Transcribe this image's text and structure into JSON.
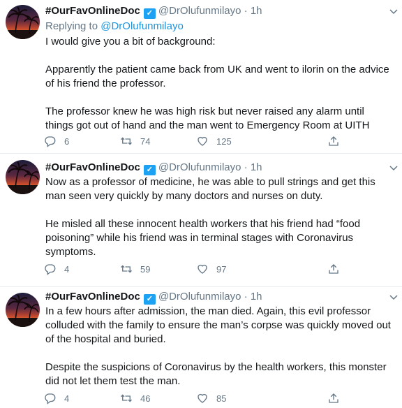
{
  "tweets": [
    {
      "display_name": "#OurFavOnlineDoc",
      "handle": "@DrOlufunmilayo",
      "separator": "·",
      "time": "1h",
      "replying_prefix": "Replying to",
      "replying_to": "@DrOlufunmilayo",
      "paragraphs": [
        "I would give you a bit of background:",
        "Apparently the patient came back from UK and went to ilorin on the advice of his friend the professor.",
        "The professor knew he was high risk but never raised any alarm until things got out of hand and the man went to Emergency Room at UITH"
      ],
      "replies": "6",
      "retweets": "74",
      "likes": "125"
    },
    {
      "display_name": "#OurFavOnlineDoc",
      "handle": "@DrOlufunmilayo",
      "separator": "·",
      "time": "1h",
      "paragraphs": [
        "Now as a professor of medicine, he was able to pull strings and get this man seen very quickly by many doctors and nurses on duty.",
        "He misled all these innocent health workers that his friend had “food poisoning” while his friend was in terminal stages with Coronavirus symptoms."
      ],
      "replies": "4",
      "retweets": "59",
      "likes": "97"
    },
    {
      "display_name": "#OurFavOnlineDoc",
      "handle": "@DrOlufunmilayo",
      "separator": "·",
      "time": "1h",
      "paragraphs": [
        "In a few hours after admission, the man died. Again, this evil professor colluded with the family to ensure the man’s corpse was quickly moved out of the hospital and buried.",
        "Despite the suspicions of Coronavirus by the health workers, this monster did not let them test the man."
      ],
      "replies": "4",
      "retweets": "46",
      "likes": "85"
    }
  ],
  "icons": {
    "reply": "reply-icon",
    "retweet": "retweet-icon",
    "like": "heart-icon",
    "share": "share-icon",
    "more": "chevron-down-icon",
    "badge": "verified-badge-icon"
  },
  "colors": {
    "text": "#14171a",
    "secondary": "#657786",
    "link": "#1b95e0",
    "divider": "#e6ecf0"
  }
}
